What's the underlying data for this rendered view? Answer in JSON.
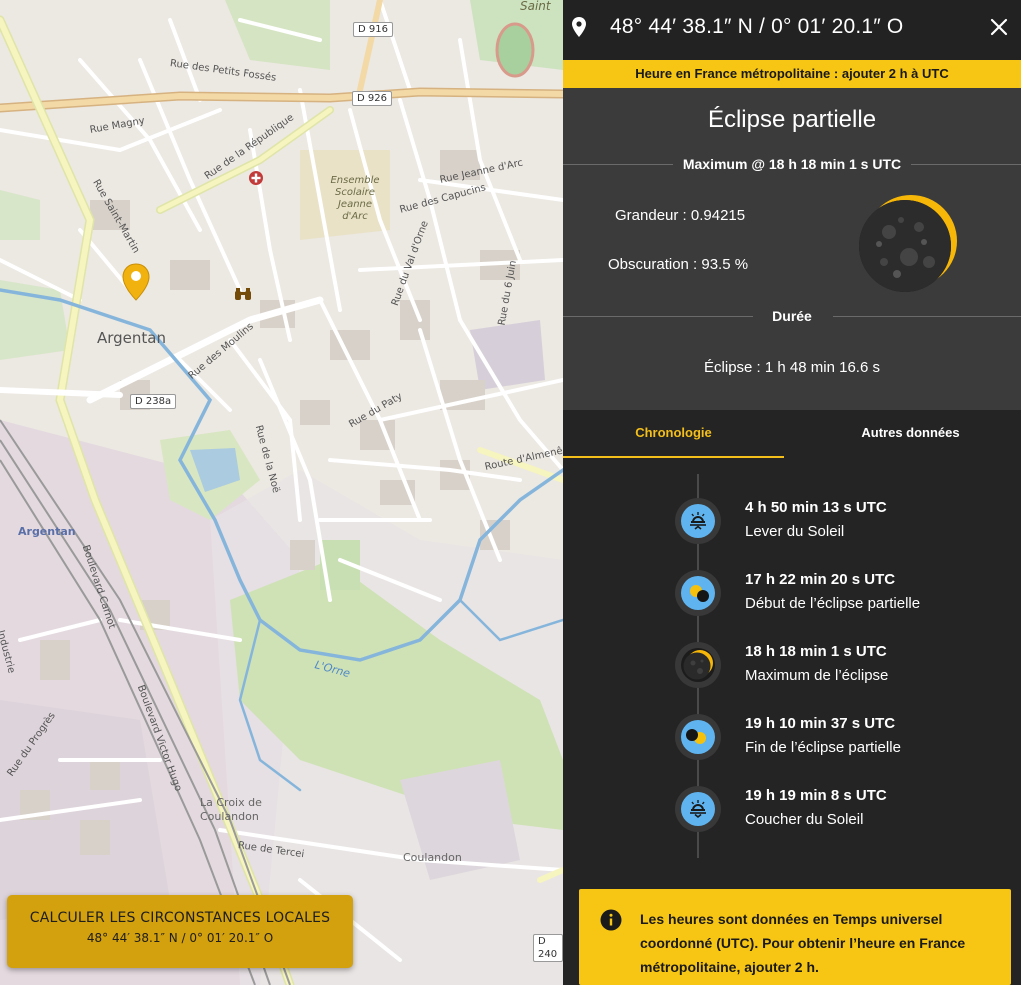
{
  "map": {
    "town_label": "Argentan",
    "station_label": "Argentan",
    "pin_icon": "location-pin-icon",
    "poi_icons": [
      "hospital-icon",
      "binoculars-icon"
    ],
    "shields": [
      "D 916",
      "D 926",
      "D 238a",
      "D 240"
    ],
    "streets": [
      "Rue des Petits Fossés",
      "Rue de la République",
      "Rue du Paty",
      "Boulevard Carnot",
      "Boulevard Victor Hugo",
      "Rue des Moulins",
      "Rue des Capucins",
      "Route d'Almenêche",
      "Rue de la Noë",
      "Rue du 6 Juin",
      "Rue du Val d'Orne",
      "Rue Jeanne d'Arc",
      "Rue Magny",
      "Rue Saint-Martin",
      "Rue de Tercei",
      "Rue du Progrès"
    ],
    "school_label": "Ensemble Scolaire Jeanne d'Arc",
    "river_label": "L'Orne",
    "places": [
      "La Croix de Coulandon",
      "Coulandon"
    ],
    "saint_label": "Saint",
    "industrie_label": "Industrie",
    "calc_button": {
      "title": "CALCULER LES CIRCONSTANCES LOCALES",
      "coords": "48° 44′ 38.1″ N / 0° 01′ 20.1″ O"
    }
  },
  "panel": {
    "header": {
      "coords": "48° 44′ 38.1″ N / 0° 01′ 20.1″ O",
      "location_icon": "location-pin-icon",
      "close_icon": "close-icon"
    },
    "timezone_banner": "Heure en France métropolitaine : ajouter 2 h à UTC",
    "summary": {
      "title": "Éclipse partielle",
      "maximum_label": "Maximum @ 18 h 18 min 1 s UTC",
      "grandeur": "Grandeur : 0.94215",
      "obscuration": "Obscuration : 93.5 %",
      "duree_label": "Durée",
      "duree_value": "Éclipse : 1 h 48 min 16.6 s",
      "eclipse_magnitude": 0.94215,
      "moon_icon": "eclipse-moon-icon"
    },
    "tabs": [
      {
        "label": "Chronologie",
        "active": true
      },
      {
        "label": "Autres données",
        "active": false
      }
    ],
    "timeline": [
      {
        "time": "4 h 50 min 13 s UTC",
        "label": "Lever du Soleil",
        "icon": "sunrise-icon"
      },
      {
        "time": "17 h 22 min 20 s UTC",
        "label": "Début de l’éclipse partielle",
        "icon": "eclipse-start-icon"
      },
      {
        "time": "18 h 18 min 1 s UTC",
        "label": "Maximum de l’éclipse",
        "icon": "eclipse-maximum-icon"
      },
      {
        "time": "19 h 10 min 37 s UTC",
        "label": "Fin de l’éclipse partielle",
        "icon": "eclipse-end-icon"
      },
      {
        "time": "19 h 19 min 8 s UTC",
        "label": "Coucher du Soleil",
        "icon": "sunset-icon"
      }
    ],
    "info": {
      "icon": "info-icon",
      "text": "Les heures sont données en Temps universel coordonné (UTC). Pour obtenir l’heure en France métropolitaine, ajouter 2 h."
    }
  },
  "colors": {
    "accent": "#f7c615",
    "tab_active": "#f4bf1a",
    "panel_bg": "#242424",
    "summary_bg": "#3b3b3b",
    "sky_blue": "#5fb4f0",
    "button_gold": "#d3a00e"
  }
}
